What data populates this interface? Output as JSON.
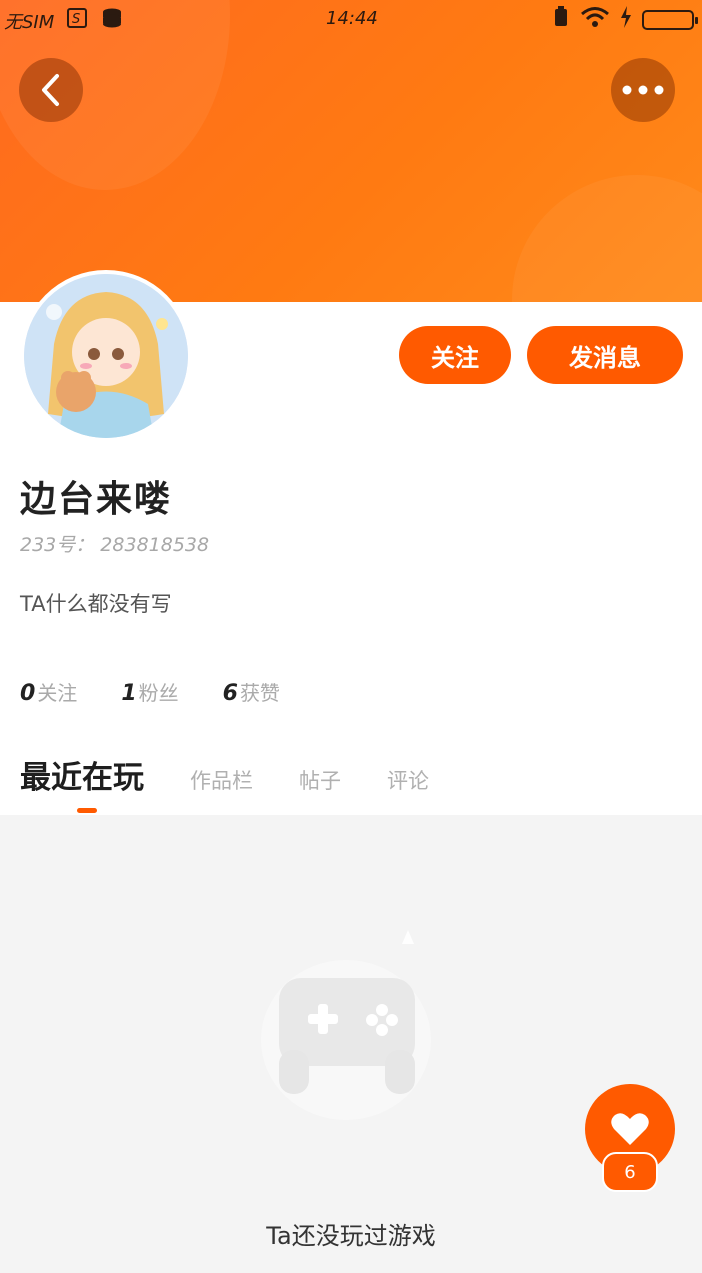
{
  "status_bar": {
    "carrier": "无SIM",
    "time": "14:44"
  },
  "header": {
    "back_icon": "chevron-left-icon",
    "more_icon": "more-dots-icon"
  },
  "profile": {
    "name": "边台来喽",
    "uid": "233号： 283818538",
    "bio": "TA什么都没有写",
    "follow_label": "关注",
    "message_label": "发消息"
  },
  "stats": [
    {
      "num": "0",
      "label": "关注"
    },
    {
      "num": "1",
      "label": "粉丝"
    },
    {
      "num": "6",
      "label": "获赞"
    }
  ],
  "tabs": [
    {
      "label": "最近在玩"
    },
    {
      "label": "作品栏"
    },
    {
      "label": "帖子"
    },
    {
      "label": "评论"
    }
  ],
  "empty_state": {
    "text": "Ta还没玩过游戏"
  },
  "like": {
    "count": "6"
  },
  "colors": {
    "accent": "#ff5a00",
    "hero_start": "#ff6a1f",
    "hero_end": "#ff8a1a"
  }
}
